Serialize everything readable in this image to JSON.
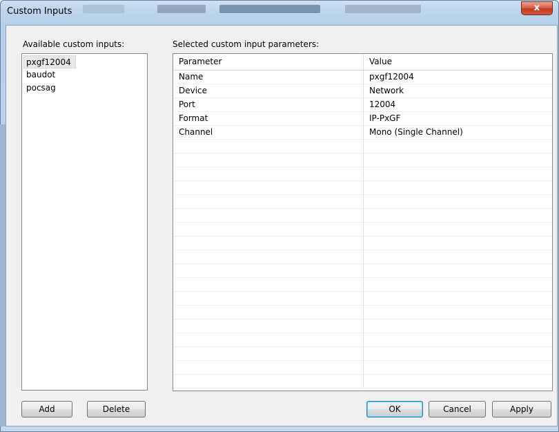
{
  "window": {
    "title": "Custom Inputs",
    "close_label": "x"
  },
  "left_panel": {
    "label": "Available custom inputs:",
    "items": [
      {
        "label": "pxgf12004",
        "selected": true
      },
      {
        "label": "baudot",
        "selected": false
      },
      {
        "label": "pocsag",
        "selected": false
      }
    ],
    "add_label": "Add",
    "delete_label": "Delete"
  },
  "right_panel": {
    "label": "Selected custom input parameters:",
    "columns": [
      "Parameter",
      "Value"
    ],
    "rows": [
      {
        "parameter": "Name",
        "value": "pxgf12004"
      },
      {
        "parameter": "Device",
        "value": "Network"
      },
      {
        "parameter": "Port",
        "value": "12004"
      },
      {
        "parameter": "Format",
        "value": "IP-PxGF"
      },
      {
        "parameter": "Channel",
        "value": "Mono (Single Channel)"
      }
    ]
  },
  "footer": {
    "ok_label": "OK",
    "cancel_label": "Cancel",
    "apply_label": "Apply"
  },
  "colors": {
    "titlebar": "#bcd4ec",
    "close_button": "#c13b22",
    "dialog_bg": "#f0f0f0",
    "default_button_border": "#3c7fb1"
  }
}
